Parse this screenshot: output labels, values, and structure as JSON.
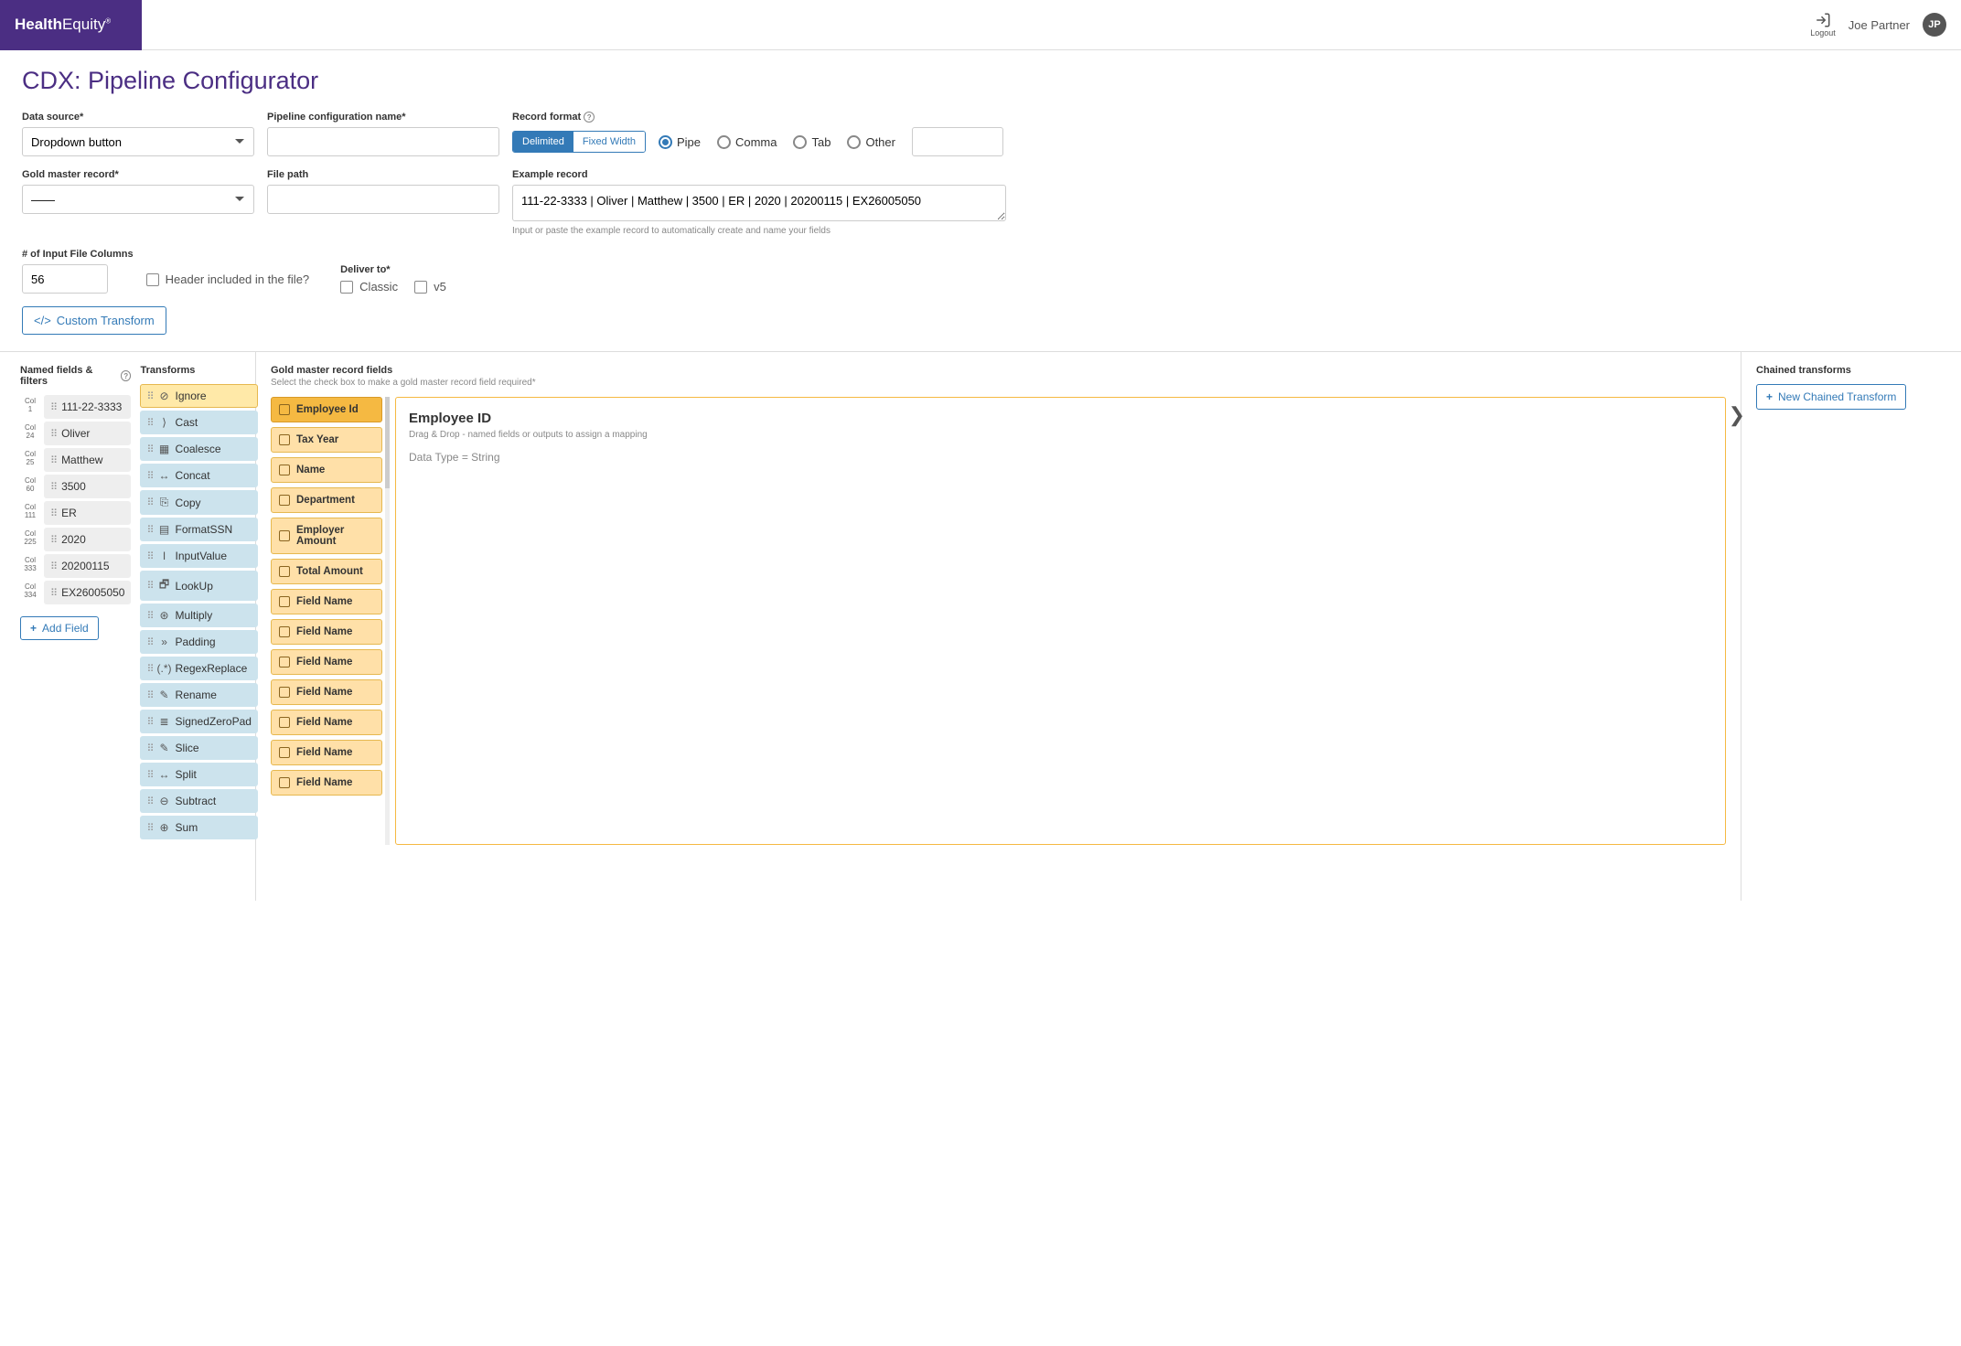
{
  "header": {
    "brand_bold": "Health",
    "brand_light": "Equity",
    "logout_label": "Logout",
    "user_name": "Joe Partner",
    "user_initials": "JP"
  },
  "page_title": "CDX: Pipeline Configurator",
  "form": {
    "data_source": {
      "label": "Data source*",
      "value": "Dropdown button"
    },
    "pipeline_name": {
      "label": "Pipeline configuration name*",
      "value": ""
    },
    "record_format": {
      "label": "Record format",
      "seg_options": [
        "Delimited",
        "Fixed Width"
      ],
      "seg_active": "Delimited",
      "radio_options": [
        "Pipe",
        "Comma",
        "Tab",
        "Other"
      ],
      "radio_selected": "Pipe",
      "other_value": ""
    },
    "gold_master": {
      "label": "Gold master record*",
      "value": "——"
    },
    "file_path": {
      "label": "File path",
      "value": ""
    },
    "example_record": {
      "label": "Example record",
      "value": "111-22-3333 | Oliver | Matthew | 3500 | ER | 2020 | 20200115 | EX26005050",
      "hint": "Input or paste the example record to automatically create and name your fields"
    },
    "input_columns": {
      "label": "# of Input File Columns",
      "value": "56"
    },
    "header_checkbox": "Header included in the file?",
    "deliver_to": {
      "label": "Deliver to*",
      "options": [
        "Classic",
        "v5"
      ]
    },
    "custom_transform_btn": "Custom Transform"
  },
  "named_fields": {
    "title": "Named fields & filters",
    "items": [
      {
        "col": "1",
        "value": "111-22-3333"
      },
      {
        "col": "24",
        "value": "Oliver"
      },
      {
        "col": "25",
        "value": "Matthew"
      },
      {
        "col": "60",
        "value": "3500"
      },
      {
        "col": "111",
        "value": "ER"
      },
      {
        "col": "225",
        "value": "2020"
      },
      {
        "col": "333",
        "value": "20200115"
      },
      {
        "col": "334",
        "value": "EX26005050"
      }
    ],
    "add_field_btn": "Add Field"
  },
  "transforms": {
    "title": "Transforms",
    "items": [
      {
        "name": "Ignore",
        "icon": "⊘",
        "highlight": true
      },
      {
        "name": "Cast",
        "icon": "⟩"
      },
      {
        "name": "Coalesce",
        "icon": "▦"
      },
      {
        "name": "Concat",
        "icon": "↔"
      },
      {
        "name": "Copy",
        "icon": "⎘"
      },
      {
        "name": "FormatSSN",
        "icon": "▤"
      },
      {
        "name": "InputValue",
        "icon": "I"
      },
      {
        "name": "LookUp",
        "icon": "🗗"
      },
      {
        "name": "Multiply",
        "icon": "⊛"
      },
      {
        "name": "Padding",
        "icon": "»"
      },
      {
        "name": "RegexReplace",
        "icon": "(.*)"
      },
      {
        "name": "Rename",
        "icon": "✎"
      },
      {
        "name": "SignedZeroPad",
        "icon": "≣"
      },
      {
        "name": "Slice",
        "icon": "✎"
      },
      {
        "name": "Split",
        "icon": "↔"
      },
      {
        "name": "Subtract",
        "icon": "⊖"
      },
      {
        "name": "Sum",
        "icon": "⊕"
      }
    ]
  },
  "gold_fields": {
    "title": "Gold master record fields",
    "subtitle": "Select the check box to make a gold master record field required*",
    "items": [
      {
        "label": "Employee Id",
        "active": true
      },
      {
        "label": "Tax Year"
      },
      {
        "label": "Name"
      },
      {
        "label": "Department"
      },
      {
        "label": "Employer Amount"
      },
      {
        "label": "Total Amount"
      },
      {
        "label": "Field Name"
      },
      {
        "label": "Field Name"
      },
      {
        "label": "Field Name"
      },
      {
        "label": "Field Name"
      },
      {
        "label": "Field Name"
      },
      {
        "label": "Field Name"
      },
      {
        "label": "Field Name"
      }
    ]
  },
  "drop_zone": {
    "title": "Employee ID",
    "hint": "Drag & Drop - named fields or outputs to assign a mapping",
    "data_type": "Data Type = String"
  },
  "chained": {
    "title": "Chained transforms",
    "new_btn": "New Chained Transform"
  }
}
